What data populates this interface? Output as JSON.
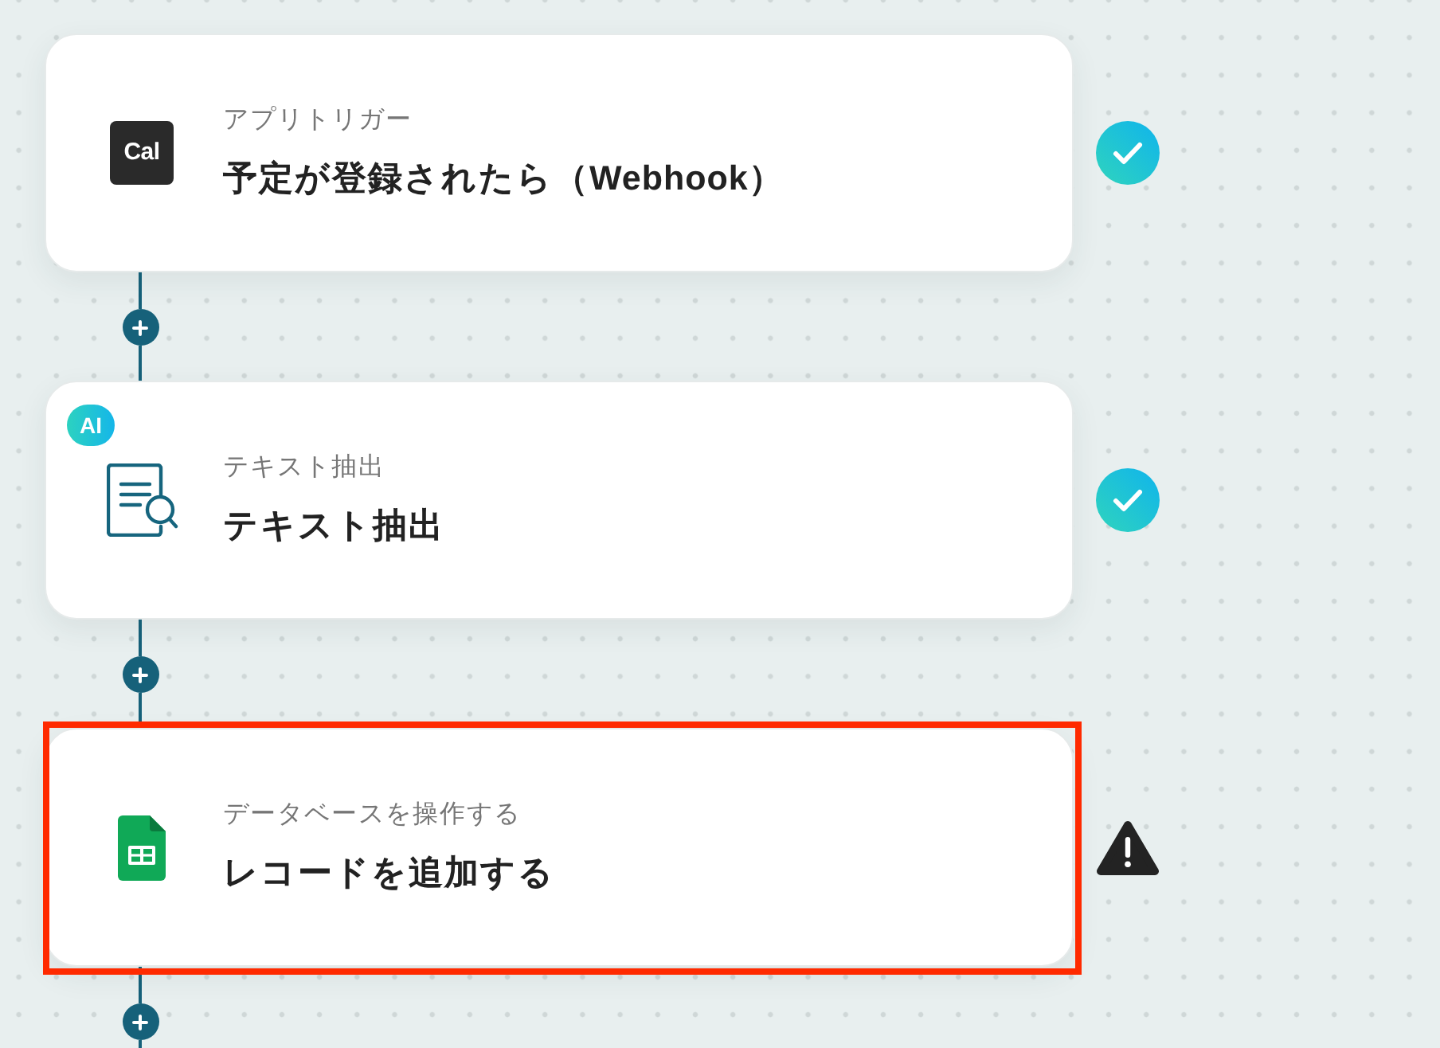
{
  "steps": [
    {
      "kind": "app",
      "logo_text": "Cal",
      "label": "アプリトリガー",
      "title": "予定が登録されたら（Webhook）",
      "completed": true,
      "highlighted": false
    },
    {
      "kind": "extract",
      "badge": "AI",
      "label": "テキスト抽出",
      "title": "テキスト抽出",
      "completed": true,
      "highlighted": false
    },
    {
      "kind": "database",
      "label": "データベースを操作する",
      "title": "レコードを追加する",
      "completed": false,
      "highlighted": true
    }
  ]
}
